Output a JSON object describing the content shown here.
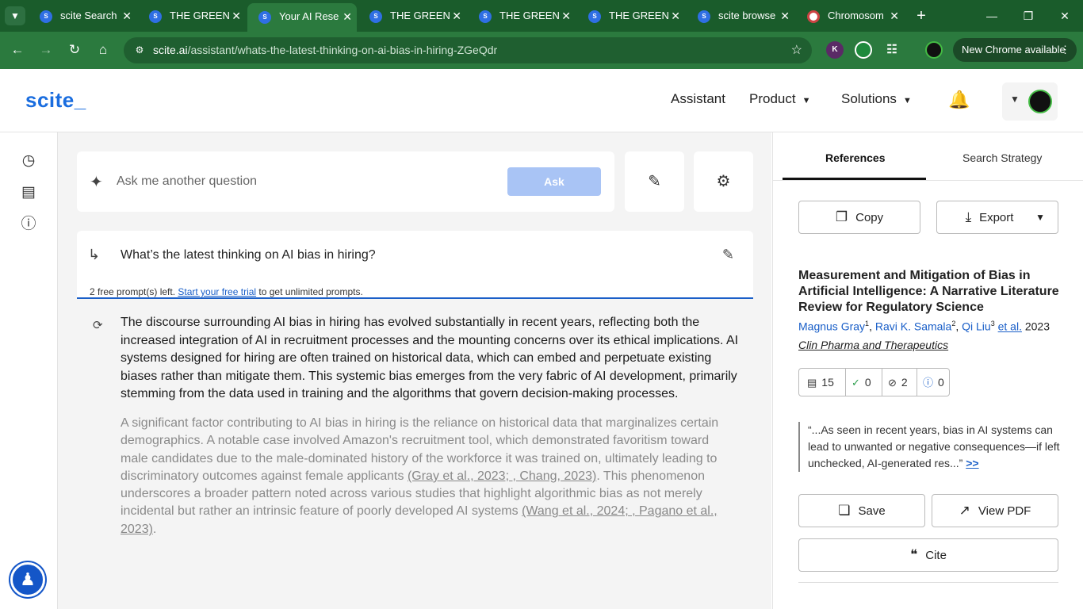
{
  "browser": {
    "tabs": [
      {
        "label": "scite Search",
        "icon": "scite-favicon"
      },
      {
        "label": "THE GREEN S",
        "icon": "scite-favicon"
      },
      {
        "label": "Your AI Rese",
        "icon": "scite-favicon",
        "active": true
      },
      {
        "label": "THE GREEN S",
        "icon": "scite-favicon"
      },
      {
        "label": "THE GREEN S",
        "icon": "scite-favicon"
      },
      {
        "label": "THE GREEN S",
        "icon": "scite-favicon"
      },
      {
        "label": "scite browse",
        "icon": "scite-favicon"
      },
      {
        "label": "Chromosom",
        "icon": "chromosome-favicon"
      }
    ],
    "url_host": "scite.ai",
    "url_path": "/assistant/whats-the-latest-thinking-on-ai-bias-in-hiring-ZGeQdr",
    "new_chrome_label": "New Chrome available",
    "ext_k": "K",
    "accent": "#2b7a3e"
  },
  "header": {
    "logo": "scite_",
    "nav": {
      "assistant": "Assistant",
      "product": "Product",
      "solutions": "Solutions"
    },
    "brand_color": "#1a6ddf"
  },
  "ask": {
    "placeholder": "Ask me another question",
    "button": "Ask"
  },
  "question": {
    "text": "What’s the latest thinking on AI bias in hiring?",
    "note_prefix": "2 free prompt(s) left. ",
    "note_link": "Start your free trial",
    "note_suffix": " to get unlimited prompts."
  },
  "answer": {
    "para1": "The discourse surrounding AI bias in hiring has evolved substantially in recent years, reflecting both the increased integration of AI in recruitment processes and the mounting concerns over its ethical implications. AI systems designed for hiring are often trained on historical data, which can embed and perpetuate existing biases rather than mitigate them. This systemic bias emerges from the very fabric of AI development, primarily stemming from the data used in training and the algorithms that govern decision-making processes.",
    "para2_a": "A significant factor contributing to AI bias in hiring is the reliance on historical data that marginalizes certain demographics. A notable case involved Amazon's recruitment tool, which demonstrated favoritism toward male candidates due to the male-dominated history of the workforce it was trained on, ultimately leading to discriminatory outcomes against female applicants ",
    "cite1": "(Gray et al., 2023; , Chang, 2023)",
    "para2_b": ". This phenomenon underscores a broader pattern noted across various studies that highlight algorithmic bias as not merely incidental but rather an intrinsic feature of poorly developed AI systems ",
    "cite2": "(Wang et al., 2024; , Pagano et al., 2023)",
    "para2_c": "."
  },
  "panel": {
    "tabs": {
      "references": "References",
      "strategy": "Search Strategy"
    },
    "copy": "Copy",
    "export": "Export",
    "paper": {
      "title": "Measurement and Mitigation of Bias in Artificial Intelligence: A Narrative Literature Review for Regulatory Science",
      "author1": "Magnus Gray",
      "sup1": "1",
      "author2": "Ravi K. Samala",
      "sup2": "2",
      "author3": "Qi Liu",
      "sup3": "3",
      "etal": "et al.",
      "year": "2023",
      "journal": "Clin Pharma and Therapeutics"
    },
    "stats": {
      "citing": "15",
      "supporting": "0",
      "mentioning": "2",
      "contrasting": "0"
    },
    "quote": "“...As seen in recent years, bias in AI systems can lead to unwanted or negative consequences—if left unchecked, AI-generated res...”",
    "quote_more": ">>",
    "save": "Save",
    "view_pdf": "View PDF",
    "cite": "Cite"
  }
}
